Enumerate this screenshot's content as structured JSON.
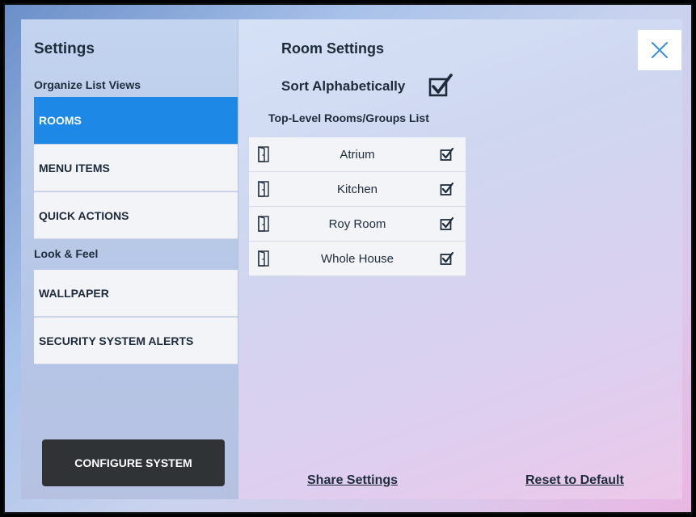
{
  "sidebar": {
    "title": "Settings",
    "section_organize": "Organize List Views",
    "section_look": "Look & Feel",
    "items": [
      {
        "label": "ROOMS"
      },
      {
        "label": "MENU ITEMS"
      },
      {
        "label": "QUICK ACTIONS"
      },
      {
        "label": "WALLPAPER"
      },
      {
        "label": "SECURITY SYSTEM ALERTS"
      }
    ],
    "configure_label": "CONFIGURE SYSTEM"
  },
  "main": {
    "title": "Room Settings",
    "sort_label": "Sort Alphabetically",
    "sort_checked": true,
    "list_title": "Top-Level Rooms/Groups List",
    "rooms": [
      {
        "name": "Atrium",
        "checked": true
      },
      {
        "name": "Kitchen",
        "checked": true
      },
      {
        "name": "Roy Room",
        "checked": true
      },
      {
        "name": "Whole House",
        "checked": true
      }
    ],
    "share_label": "Share Settings",
    "reset_label": "Reset to Default"
  },
  "colors": {
    "accent": "#1d88e6",
    "close_icon": "#3a8fd8",
    "button_dark": "#303336"
  },
  "icons": {
    "close": "close-icon",
    "door": "door-icon",
    "check": "checkbox-checked-icon"
  }
}
